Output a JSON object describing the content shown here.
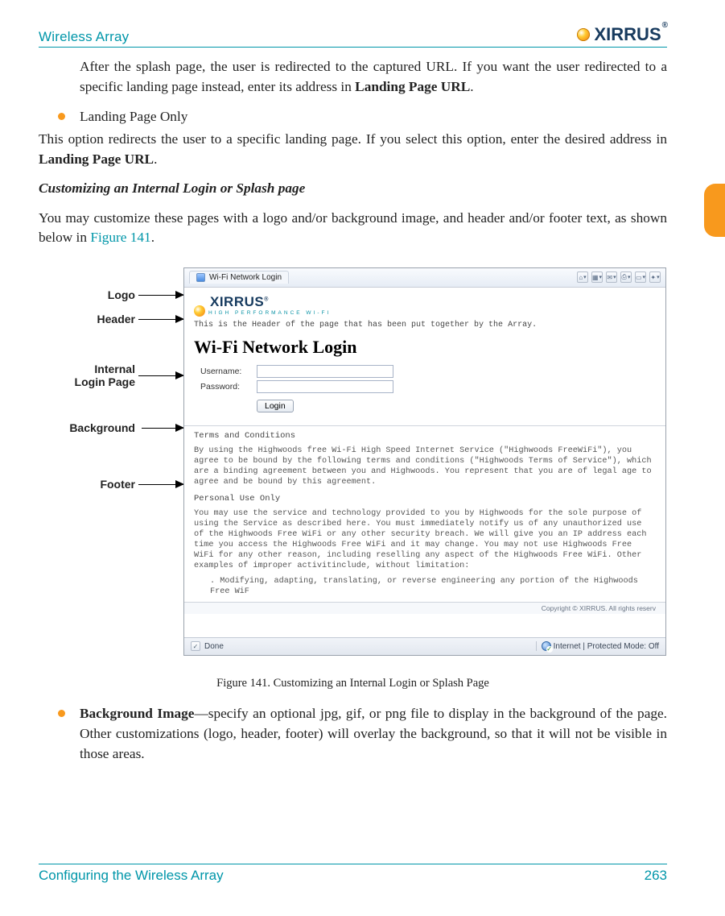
{
  "header": {
    "left": "Wireless Array",
    "logo_text": "XIRRUS"
  },
  "intro": {
    "p1a": "After the splash page, the user is redirected to the captured URL. If you want the user redirected to a specific landing page instead, enter its address in ",
    "p1b": "Landing Page URL",
    "p1c": "."
  },
  "bullet1": {
    "title": "Landing Page Only",
    "body_a": "This option redirects the user to a specific landing page. If you select this option, enter the desired address in ",
    "body_b": "Landing Page URL",
    "body_c": "."
  },
  "section": {
    "heading": "Customizing an Internal Login or Splash page",
    "body_a": "You may customize these pages with a logo and/or background image, and header and/or footer text, as shown below in ",
    "body_link": "Figure 141",
    "body_b": "."
  },
  "callouts": {
    "logo": "Logo",
    "header": "Header",
    "internal1": "Internal",
    "internal2": "Login Page",
    "background": "Background",
    "footer": "Footer"
  },
  "figure": {
    "tab_title": "Wi-Fi Network Login",
    "fig_logo_word": "XIRRUS",
    "fig_logo_tag": "HIGH PERFORMANCE WI-FI",
    "header_text": "This is the Header of the page that has been put together by the Array.",
    "login_heading": "Wi-Fi Network Login",
    "label_user": "Username:",
    "label_pass": "Password:",
    "login_btn": "Login",
    "terms_head": "Terms and Conditions",
    "terms_p1": "By using the Highwoods free Wi-Fi High Speed Internet Service (\"Highwoods FreeWiFi\"), you agree to be bound by the following terms and conditions (\"Highwoods Terms of Service\"), which are a binding agreement between you and Highwoods. You represent that you are of legal age to agree and be bound by this agreement.",
    "terms_sub": "Personal Use Only",
    "terms_p2": "You may use the service and technology provided to you by Highwoods for the sole purpose of using the Service as described here. You must immediately notify us of any unauthorized use of the Highwoods Free WiFi or any other security breach. We will give you an IP address each time you access the Highwoods Free WiFi and it may change. You may not use Highwoods Free WiFi for any other reason, including reselling any aspect of the Highwoods Free WiFi. Other examples of improper activitinclude, without limitation:",
    "terms_li": ". Modifying, adapting, translating, or reverse engineering any portion of the Highwoods Free WiF",
    "copyright": "Copyright © XIRRUS. All rights reserv",
    "status_done": "Done",
    "status_zone": "Internet | Protected Mode: Off"
  },
  "figure_caption": "Figure 141. Customizing an Internal Login or Splash Page",
  "bullet2": {
    "strong": "Background Image",
    "rest": "—specify an optional jpg, gif, or png file to display in the background of the page. Other customizations (logo, header, footer) will overlay the background, so that it will not be visible in those areas."
  },
  "footer": {
    "left": "Configuring the Wireless Array",
    "right": "263"
  }
}
